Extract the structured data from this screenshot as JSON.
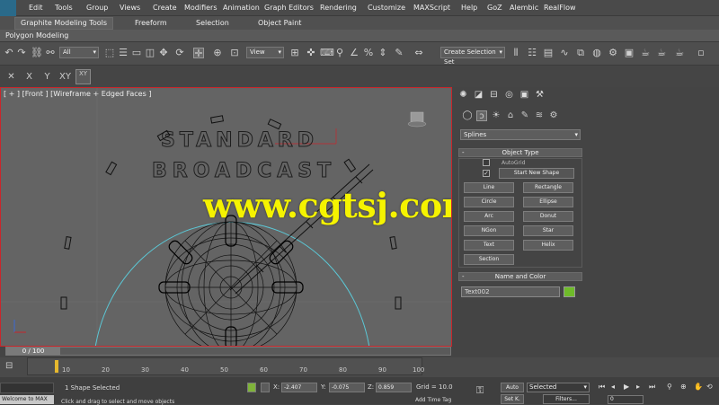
{
  "menubar": {
    "items": [
      "Edit",
      "Tools",
      "Group",
      "Views",
      "Create",
      "Modifiers",
      "Animation",
      "Graph Editors",
      "Rendering",
      "Customize",
      "MAXScript",
      "Help",
      "GoZ",
      "Alembic",
      "RealFlow"
    ]
  },
  "ribbon": {
    "tabs": [
      "Graphite Modeling Tools",
      "Freeform",
      "Selection",
      "Object Paint"
    ],
    "panel_label": "Polygon Modeling"
  },
  "main_toolbar": {
    "selection_filter": "All",
    "reference_coord": "View",
    "named_selection": "Create Selection Set"
  },
  "axis_constraints": [
    "X",
    "Y",
    "Z",
    "XY",
    "XY"
  ],
  "viewport": {
    "label": "[ + ] [Front ] [Wireframe + Edged Faces ]",
    "text_line1": "STANDARD",
    "text_line2": "BROADCAST",
    "watermark": "www.cgtsj.com",
    "frame_slider": "0 / 100"
  },
  "command_panel": {
    "category": "Splines",
    "object_type_header": "Object Type",
    "autogrid_label": "AutoGrid",
    "start_new_shape_label": "Start New Shape",
    "object_buttons": [
      "Line",
      "Rectangle",
      "Circle",
      "Ellipse",
      "Arc",
      "Donut",
      "NGon",
      "Star",
      "Text",
      "Helix",
      "Section"
    ],
    "name_color_header": "Name and Color",
    "object_name": "Text002",
    "object_color": "#6fbb2a"
  },
  "track_bar": {
    "ticks": [
      "0",
      "10",
      "20",
      "30",
      "40",
      "50",
      "60",
      "70",
      "80",
      "90",
      "100"
    ]
  },
  "status_bar": {
    "maxscript_label": "Welcome to MAX",
    "selection_status": "1 Shape Selected",
    "prompt": "Click and drag to select and move objects",
    "x_label": "X:",
    "x_value": "-2.407",
    "y_label": "Y:",
    "y_value": "-0.075",
    "z_label": "Z:",
    "z_value": "0.859",
    "grid_label": "Grid = 10.0",
    "add_time_tag": "Add Time Tag",
    "auto_key": "Auto",
    "set_key": "Set K.",
    "selected_dropdown": "Selected",
    "filters": "Filters...",
    "current_frame": "0"
  }
}
